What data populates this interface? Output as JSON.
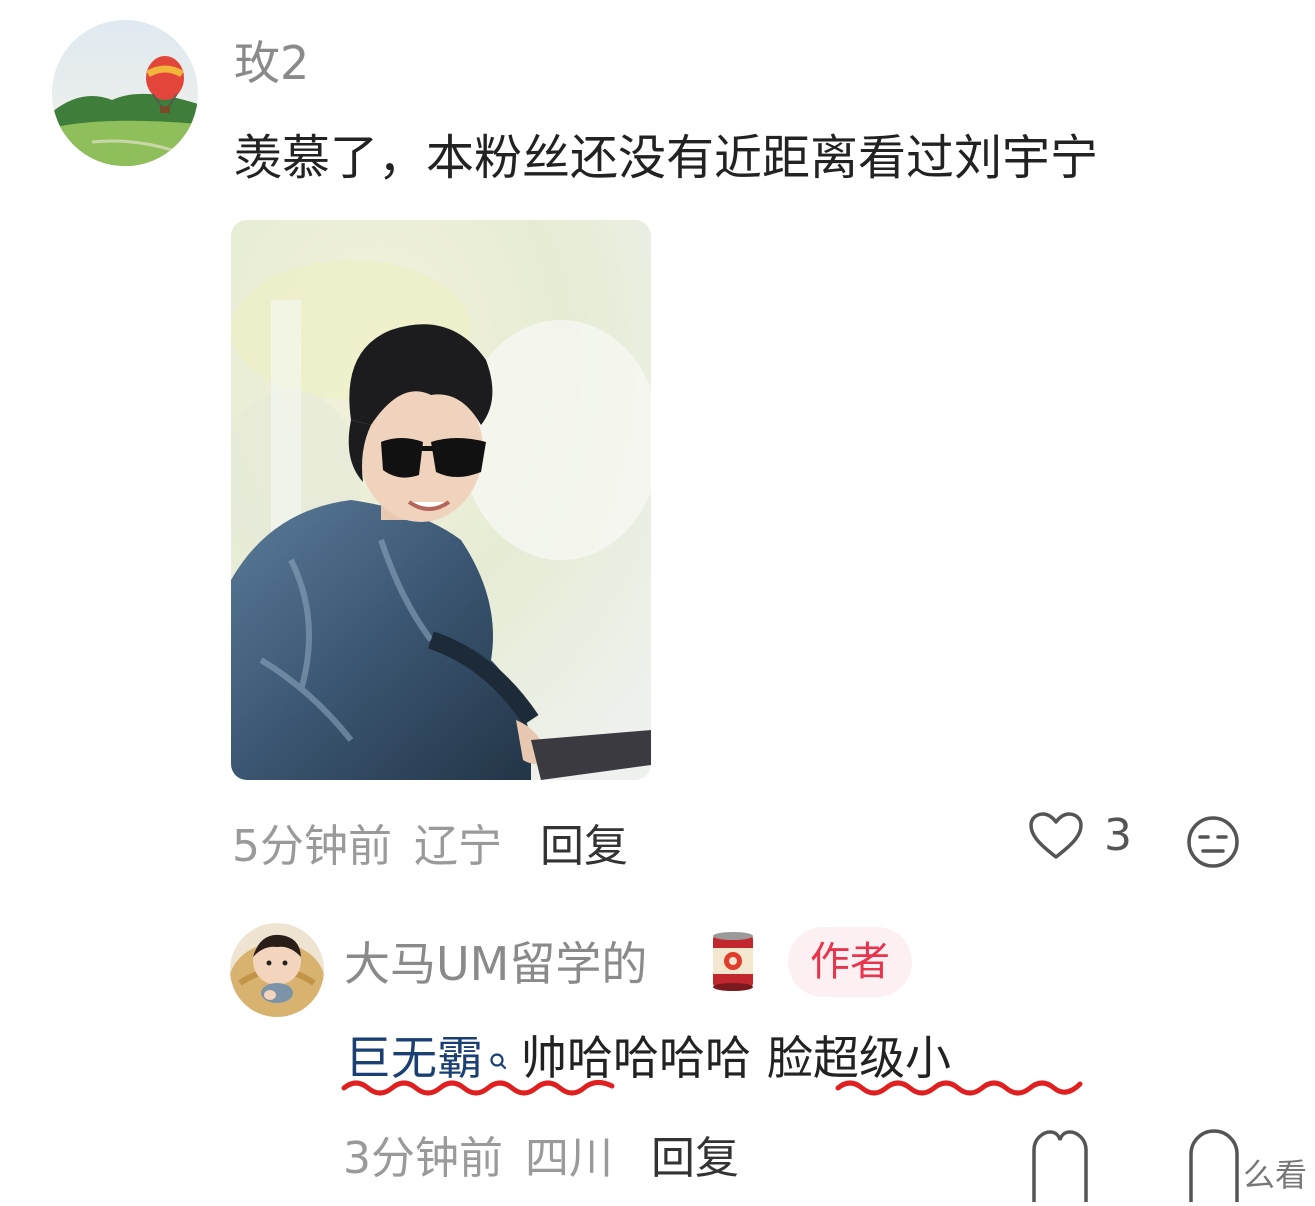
{
  "comment": {
    "username": "玫2",
    "text": "羡慕了，本粉丝还没有近距离看过刘宇宁",
    "time": "5分钟前",
    "location": "辽宁",
    "reply_label": "回复",
    "like_count": "3",
    "avatar_icon": "hot-air-balloon-landscape-avatar",
    "photo_icon": "man-in-sunglasses-photo"
  },
  "reply": {
    "username": "大马UM留学的",
    "username_emoji": "tomato-can-icon",
    "badge": "作者",
    "keyword": "巨无霸",
    "text_mid": "帅哈哈哈哈",
    "text_end": "脸超级小",
    "time": "3分钟前",
    "location": "四川",
    "reply_label": "回复",
    "avatar_icon": "baby-photo-avatar"
  },
  "watermark": "么看",
  "colors": {
    "link": "#1a3f73",
    "badge_text": "#e8354d",
    "badge_bg": "#fdf0f2",
    "squiggle": "#e02020",
    "meta": "#9a9a9a"
  }
}
